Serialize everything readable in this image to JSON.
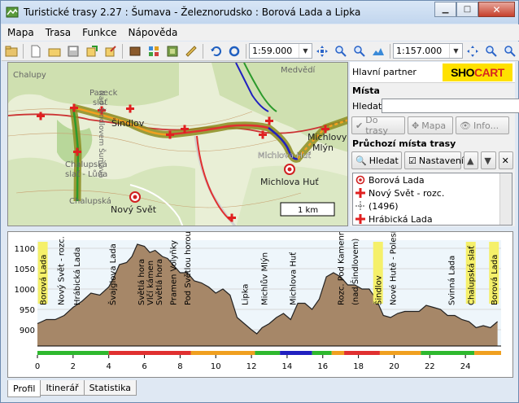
{
  "window": {
    "title": "Turistické trasy 2.27 : Šumava - Železnorudsko : Borová Lada a Lipka",
    "buttons": [
      "minimize",
      "maximize",
      "close"
    ]
  },
  "menu": [
    {
      "label": "Mapa",
      "accel": "M"
    },
    {
      "label": "Trasa",
      "accel": "T"
    },
    {
      "label": "Funkce",
      "accel": "F"
    },
    {
      "label": "Nápověda",
      "accel": "N"
    }
  ],
  "toolbar": {
    "scale1": "1:59.000",
    "scale2": "1:157.000",
    "icons": [
      "open-folder-icon",
      "new-document-icon",
      "open-icon",
      "save-icon",
      "export-icon",
      "import-icon",
      "book-icon",
      "grid-icon",
      "layers-icon",
      "ruler-icon",
      "undo-icon",
      "circle-icon"
    ],
    "nav_icons": [
      "move-icon",
      "zoom-in-icon",
      "zoom-out-icon",
      "profile-icon"
    ]
  },
  "map": {
    "labels": [
      {
        "text": "Chalupy",
        "style": "gray"
      },
      {
        "text": "Paseck",
        "style": "gray"
      },
      {
        "text": "slať",
        "style": "gray"
      },
      {
        "text": "Medvědí",
        "style": "gray"
      },
      {
        "text": "Šindlov",
        "style": "bold"
      },
      {
        "text": "Chalupská",
        "style": "gray"
      },
      {
        "text": "slať - Lůna",
        "style": "gray"
      },
      {
        "text": "Nový Svět",
        "style": "bold"
      },
      {
        "text": "Chalupská",
        "style": "gray"
      },
      {
        "text": "Michlovy",
        "style": "bold"
      },
      {
        "text": "Mlýn",
        "style": "bold"
      },
      {
        "text": "Michlova Huť",
        "style": "white"
      },
      {
        "text": "Michlova Huť",
        "style": "bold"
      },
      {
        "text": "Nad Šindlovem Šumava",
        "style": "gray"
      }
    ],
    "scale_label": "1 km"
  },
  "side": {
    "partner_label": "Hlavní partner",
    "logo_text_a": "SHO",
    "logo_text_b": "CART",
    "places_title": "Místa",
    "search_label": "Hledat",
    "search_value": "",
    "btn_route": "Do trasy",
    "btn_map": "Mapa",
    "btn_info": "Info...",
    "route_points_title": "Průchozí místa trasy",
    "btn_search": "Hledat",
    "btn_settings": "Nastavení",
    "list": [
      {
        "icon": "target-icon",
        "label": "Borová Lada"
      },
      {
        "icon": "red-cross-icon",
        "label": "Nový Svět - rozc."
      },
      {
        "icon": "elevation-icon",
        "label": "(1496)"
      },
      {
        "icon": "red-cross-icon",
        "label": "Hrábická Lada"
      }
    ]
  },
  "chart_data": {
    "type": "area",
    "title": "",
    "xlabel": "",
    "ylabel": "",
    "x_ticks": [
      0,
      2,
      4,
      6,
      8,
      10,
      12,
      14,
      16,
      18,
      20,
      22,
      24
    ],
    "y_ticks": [
      900,
      950,
      1000,
      1050,
      1100
    ],
    "xlim": [
      0,
      26
    ],
    "ylim": [
      860,
      1120
    ],
    "x": [
      0,
      0.5,
      1,
      1.5,
      2,
      2.5,
      3,
      3.5,
      4,
      4.3,
      4.6,
      5,
      5.3,
      5.6,
      6,
      6.3,
      6.6,
      7,
      7.3,
      7.6,
      8,
      8.4,
      8.8,
      9.2,
      9.6,
      10,
      10.4,
      10.8,
      11.2,
      11.6,
      12,
      12.3,
      12.6,
      13,
      13.4,
      13.8,
      14.2,
      14.6,
      15,
      15.4,
      15.8,
      16.2,
      16.6,
      17,
      17.4,
      17.8,
      18.2,
      18.6,
      19,
      19.4,
      19.8,
      20.2,
      20.6,
      21,
      21.4,
      21.8,
      22.2,
      22.6,
      23,
      23.4,
      23.8,
      24.2,
      24.6,
      25,
      25.4,
      25.8
    ],
    "y": [
      915,
      925,
      925,
      935,
      955,
      970,
      990,
      985,
      1005,
      1030,
      1060,
      1065,
      1080,
      1110,
      1105,
      1090,
      1095,
      1080,
      1075,
      1060,
      1040,
      1040,
      1020,
      1015,
      1005,
      990,
      1000,
      985,
      930,
      915,
      900,
      890,
      905,
      915,
      930,
      940,
      925,
      965,
      965,
      950,
      975,
      1030,
      1040,
      1030,
      1010,
      1010,
      1000,
      1000,
      975,
      935,
      930,
      940,
      945,
      945,
      945,
      960,
      955,
      950,
      935,
      935,
      925,
      920,
      905,
      910,
      905,
      920
    ],
    "waypoints": [
      {
        "x": 0.3,
        "label": "Borová Lada",
        "highlight": true
      },
      {
        "x": 1.3,
        "label": "Nový Svět - rozc.",
        "highlight": false
      },
      {
        "x": 2.2,
        "label": "Hrábická Lada",
        "highlight": false
      },
      {
        "x": 4.2,
        "label": "Švajglova Lada",
        "highlight": false
      },
      {
        "x": 5.8,
        "label": "Světlá hora",
        "highlight": false
      },
      {
        "x": 6.3,
        "label": "Vlčí kámen",
        "highlight": false
      },
      {
        "x": 6.8,
        "label": "Světlá hora",
        "highlight": false
      },
      {
        "x": 7.6,
        "label": "Pramen Volyňky",
        "highlight": false
      },
      {
        "x": 8.4,
        "label": "Pod Světlou horou",
        "highlight": false
      },
      {
        "x": 11.6,
        "label": "Lipka",
        "highlight": false
      },
      {
        "x": 12.7,
        "label": "Michlův Mlýn",
        "highlight": false
      },
      {
        "x": 14.3,
        "label": "Michlova Huť",
        "highlight": false
      },
      {
        "x": 17.0,
        "label": "Rozc. Pod Kamennou",
        "highlight": false
      },
      {
        "x": 17.8,
        "label": "(nad Šindlovem)",
        "highlight": false
      },
      {
        "x": 19.1,
        "label": "Šindlov",
        "highlight": true
      },
      {
        "x": 19.9,
        "label": "Nové Hutě - Polesí",
        "highlight": false
      },
      {
        "x": 23.2,
        "label": "Svinná Lada",
        "highlight": false
      },
      {
        "x": 24.3,
        "label": "Chalupská slať",
        "highlight": true
      },
      {
        "x": 25.6,
        "label": "Borová Lada",
        "highlight": true
      }
    ],
    "route_bar": [
      {
        "from": 0,
        "to": 4,
        "color": "#2eb82e"
      },
      {
        "from": 4,
        "to": 8.6,
        "color": "#e03030"
      },
      {
        "from": 8.6,
        "to": 12.2,
        "color": "#f0a020"
      },
      {
        "from": 12.2,
        "to": 13.6,
        "color": "#2eb82e"
      },
      {
        "from": 13.6,
        "to": 15.4,
        "color": "#2020c0"
      },
      {
        "from": 15.4,
        "to": 16.5,
        "color": "#2eb82e"
      },
      {
        "from": 16.5,
        "to": 17.2,
        "color": "#f0a020"
      },
      {
        "from": 17.2,
        "to": 19.2,
        "color": "#e03030"
      },
      {
        "from": 19.2,
        "to": 21.5,
        "color": "#f0a020"
      },
      {
        "from": 21.5,
        "to": 24.5,
        "color": "#2eb82e"
      },
      {
        "from": 24.5,
        "to": 26,
        "color": "#f0a020"
      }
    ]
  },
  "tabs": [
    {
      "label": "Profil",
      "active": true
    },
    {
      "label": "Itinerář",
      "active": false
    },
    {
      "label": "Statistika",
      "active": false
    }
  ]
}
